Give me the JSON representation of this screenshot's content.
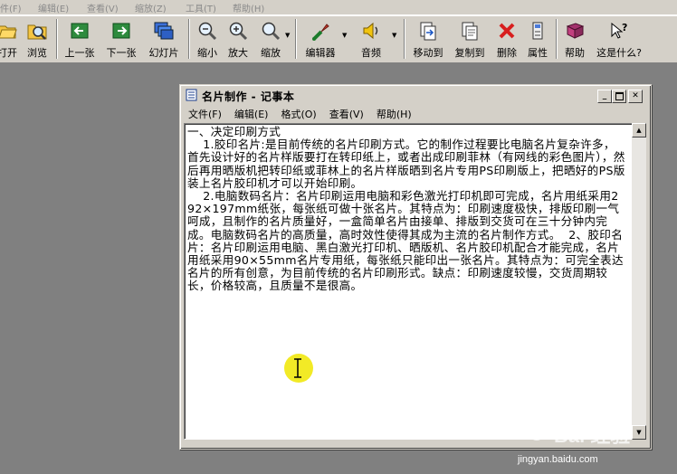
{
  "host_menu": [
    {
      "label": "件(F)"
    },
    {
      "label": "编辑(E)"
    },
    {
      "label": "查看(V)"
    },
    {
      "label": "缩放(Z)"
    },
    {
      "label": "工具(T)"
    },
    {
      "label": "帮助(H)"
    }
  ],
  "toolbar": {
    "open": "打开",
    "browse": "浏览",
    "prev": "上一张",
    "next": "下一张",
    "slideshow": "幻灯片",
    "zoom_out": "缩小",
    "zoom_in": "放大",
    "zoom": "缩放",
    "editor": "编辑器",
    "audio": "音频",
    "move_to": "移动到",
    "copy_to": "复制到",
    "delete": "删除",
    "properties": "属性",
    "help": "帮助",
    "whats_this": "这是什么?"
  },
  "notepad": {
    "title": "名片制作 - 记事本",
    "menu": [
      "文件(F)",
      "编辑(E)",
      "格式(O)",
      "查看(V)",
      "帮助(H)"
    ],
    "content": "一、决定印刷方式\n    1.胶印名片:是目前传统的名片印刷方式。它的制作过程要比电脑名片复杂许多，首先设计好的名片样版要打在转印纸上，或者出成印刷菲林（有网线的彩色图片），然后再用晒版机把转印纸或菲林上的名片样版晒到名片专用PS印刷版上，把晒好的PS版装上名片胶印机才可以开始印刷。\n    2.电脑数码名片：名片印刷运用电脑和彩色激光打印机即可完成，名片用纸采用292×197mm纸张，每张纸可做十张名片。其特点为：印刷速度极快，排版印刷一气呵成，且制作的名片质量好，一盒简单名片由接单、排版到交货可在三十分钟内完成。电脑数码名片的高质量，高时效性使得其成为主流的名片制作方式。  2、胶印名片：名片印刷运用电脑、黑白激光打印机、晒版机、名片胶印机配合才能完成，名片用纸采用90×55mm名片专用纸，每张纸只能印出一张名片。其特点为：可完全表达名片的所有创意，为目前传统的名片印刷形式。缺点：印刷速度较慢，交货周期较长，价格较高，且质量不是很高。"
  },
  "watermark": {
    "brand": "Bai 经验",
    "url": "jingyan.baidu.com"
  },
  "colors": {
    "desktop": "#808080",
    "chrome": "#d4d0c8",
    "highlight": "#f0e600"
  }
}
